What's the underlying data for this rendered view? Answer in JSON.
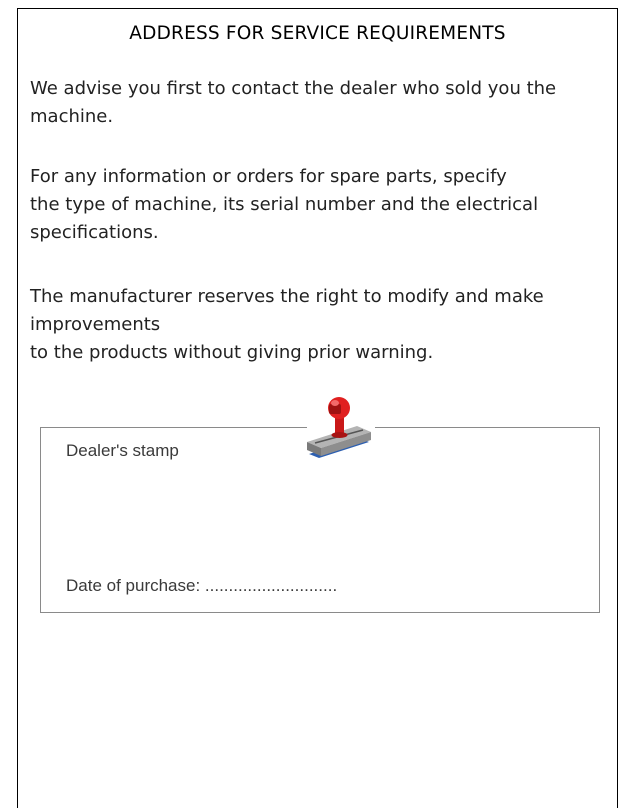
{
  "heading": "ADDRESS FOR SERVICE REQUIREMENTS",
  "paragraphs": {
    "p1": [
      "We advise you first to contact the dealer who sold you the",
      "machine."
    ],
    "p2": [
      "For any information or orders for spare parts, specify",
      "the type of machine, its serial number and the electrical",
      "specifications."
    ],
    "p3": [
      "The manufacturer reserves the right to modify and make",
      "improvements",
      "to the products without giving prior warning."
    ]
  },
  "stamp_box": {
    "label": "Dealer's stamp",
    "date_label": "Date of purchase: ............................",
    "icon": "rubber-stamp-icon"
  },
  "colors": {
    "stamp_handle": "#d81e1e",
    "stamp_base": "#9a9a9a",
    "stamp_pad": "#2d5fb0",
    "box_border": "#8a8a8a"
  }
}
